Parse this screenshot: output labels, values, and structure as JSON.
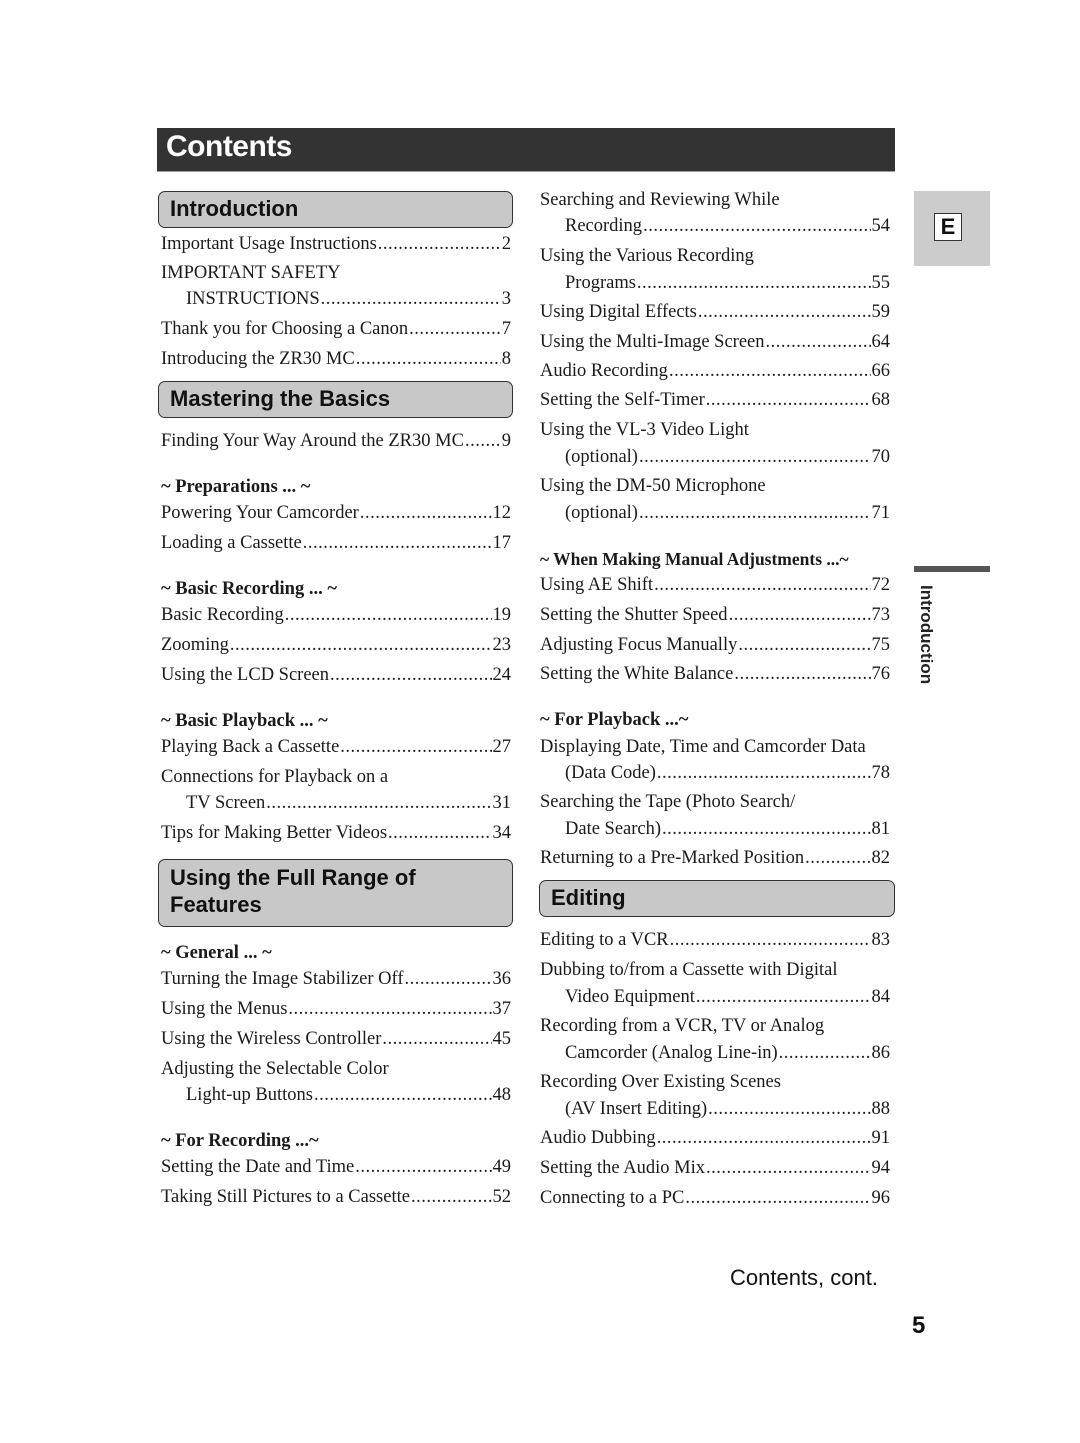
{
  "page": {
    "title": "Contents",
    "language_tab": "E",
    "side_label": "Introduction",
    "footer_continued": "Contents, cont.",
    "page_number": "5"
  },
  "left": {
    "introduction": {
      "heading": "Introduction",
      "entries": [
        {
          "title": "Important Usage Instructions",
          "page": "2"
        },
        {
          "title1": "IMPORTANT SAFETY",
          "title": "INSTRUCTIONS",
          "page": "3"
        },
        {
          "title": "Thank you for Choosing a Canon",
          "page": "7"
        },
        {
          "title": "Introducing the ZR30 MC",
          "page": "8"
        }
      ]
    },
    "basics": {
      "heading": "Mastering the Basics",
      "entries": [
        {
          "title": "Finding Your Way Around the ZR30 MC",
          "page": "9"
        }
      ],
      "preparations": {
        "label": "~ Preparations ... ~",
        "entries": [
          {
            "title": "Powering Your Camcorder",
            "page": "12"
          },
          {
            "title": "Loading a Cassette",
            "page": "17"
          }
        ]
      },
      "basic_recording": {
        "label": "~ Basic Recording ... ~",
        "entries": [
          {
            "title": "Basic Recording",
            "page": "19"
          },
          {
            "title": "Zooming",
            "page": "23"
          },
          {
            "title": "Using the LCD Screen",
            "page": "24"
          }
        ]
      },
      "basic_playback": {
        "label": "~ Basic Playback ... ~",
        "entries": [
          {
            "title": "Playing Back a Cassette",
            "page": "27"
          },
          {
            "title1": "Connections for Playback on a",
            "title": "TV Screen",
            "page": "31"
          },
          {
            "title": "Tips for Making Better Videos",
            "page": "34"
          }
        ]
      }
    },
    "features": {
      "heading_line1": "Using the Full Range of",
      "heading_line2": "Features",
      "general": {
        "label": "~ General ... ~",
        "entries": [
          {
            "title": "Turning the Image Stabilizer Off",
            "page": "36"
          },
          {
            "title": "Using the Menus",
            "page": "37"
          },
          {
            "title": "Using the Wireless Controller",
            "page": "45"
          },
          {
            "title1": "Adjusting the Selectable Color",
            "title": "Light-up Buttons",
            "page": "48"
          }
        ]
      },
      "for_recording": {
        "label": "~ For Recording ...~",
        "entries": [
          {
            "title": "Setting the Date and Time",
            "page": "49"
          },
          {
            "title": "Taking Still Pictures to a Cassette",
            "page": "52"
          }
        ]
      }
    }
  },
  "right": {
    "recording_cont": {
      "entries": [
        {
          "title1": "Searching and Reviewing While",
          "title": "Recording",
          "page": "54"
        },
        {
          "title1": "Using the Various Recording",
          "title": "Programs",
          "page": "55"
        },
        {
          "title": "Using Digital Effects",
          "page": "59"
        },
        {
          "title": "Using the Multi-Image Screen",
          "page": "64"
        },
        {
          "title": "Audio Recording",
          "page": "66"
        },
        {
          "title": "Setting the Self-Timer",
          "page": "68"
        },
        {
          "title1": "Using the VL-3 Video Light",
          "title": "(optional)",
          "page": "70"
        },
        {
          "title1": "Using the DM-50 Microphone",
          "title": "(optional)",
          "page": "71"
        }
      ]
    },
    "manual": {
      "label": "~ When Making Manual Adjustments ...~",
      "entries": [
        {
          "title": "Using AE Shift",
          "page": "72"
        },
        {
          "title": "Setting the Shutter Speed",
          "page": "73"
        },
        {
          "title": "Adjusting Focus Manually",
          "page": "75"
        },
        {
          "title": "Setting the White Balance",
          "page": "76"
        }
      ]
    },
    "playback": {
      "label": "~ For Playback ...~",
      "entries": [
        {
          "title1": "Displaying Date, Time and Camcorder Data",
          "title": "(Data Code)",
          "page": "78"
        },
        {
          "title1": "Searching the Tape (Photo Search/",
          "title": "Date Search)",
          "page": "81"
        },
        {
          "title": "Returning to a Pre-Marked Position",
          "page": "82"
        }
      ]
    },
    "editing": {
      "heading": "Editing",
      "entries": [
        {
          "title": "Editing to a VCR",
          "page": "83"
        },
        {
          "title1": "Dubbing to/from a Cassette with Digital",
          "title": "Video Equipment",
          "page": "84"
        },
        {
          "title1": "Recording from a VCR, TV or Analog",
          "title": "Camcorder (Analog Line-in)",
          "page": "86"
        },
        {
          "title1": "Recording Over Existing Scenes",
          "title": "(AV Insert Editing)",
          "page": "88"
        },
        {
          "title": "Audio Dubbing",
          "page": "91"
        },
        {
          "title": "Setting the Audio Mix",
          "page": "94"
        },
        {
          "title": "Connecting to a PC",
          "page": "96"
        }
      ]
    }
  }
}
